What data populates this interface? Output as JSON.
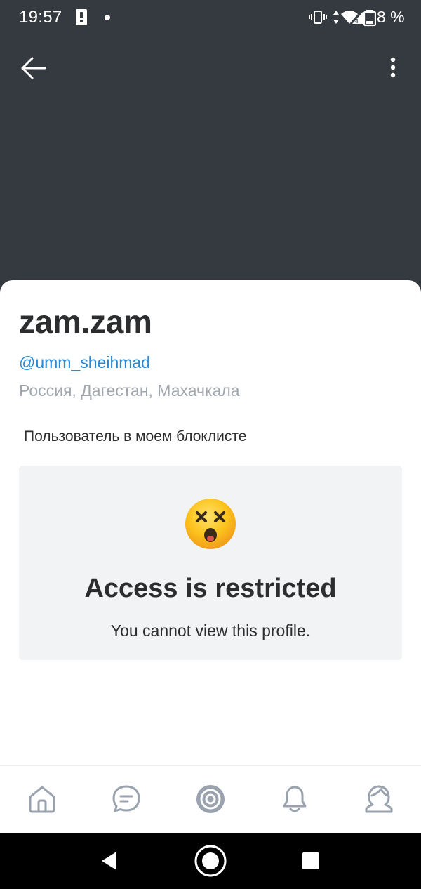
{
  "status_bar": {
    "time": "19:57",
    "battery_percent": "8 %",
    "icons": [
      "alert-icon",
      "notification-dot-icon",
      "vibrate-icon",
      "data-arrows-icon",
      "wifi-icon",
      "signal-4g-icon",
      "battery-icon"
    ]
  },
  "header": {
    "icons": [
      "back-arrow-icon",
      "more-vertical-icon"
    ],
    "background_color": "#353a40"
  },
  "profile": {
    "name": "zam.zam",
    "handle": "@umm_sheihmad",
    "location": "Россия, Дагестан, Махачкала",
    "blocklist_note": "Пользователь в моем блоклисте"
  },
  "restricted": {
    "emoji": "😵",
    "title": "Access is restricted",
    "subtitle": "You cannot view this profile."
  },
  "tabbar": {
    "tabs": [
      {
        "icon": "home-icon"
      },
      {
        "icon": "messages-icon"
      },
      {
        "icon": "discover-icon"
      },
      {
        "icon": "notifications-bell-icon"
      },
      {
        "icon": "profile-icon"
      }
    ]
  },
  "system_nav": {
    "icons": [
      "nav-back-icon",
      "nav-home-icon",
      "nav-recents-icon"
    ]
  },
  "colors": {
    "accent_link": "#2688d6",
    "secondary_text": "#a1a7ae",
    "primary_text": "#2c2d2e",
    "tab_icon": "#99a2ad",
    "panel_background": "#f2f3f5"
  }
}
